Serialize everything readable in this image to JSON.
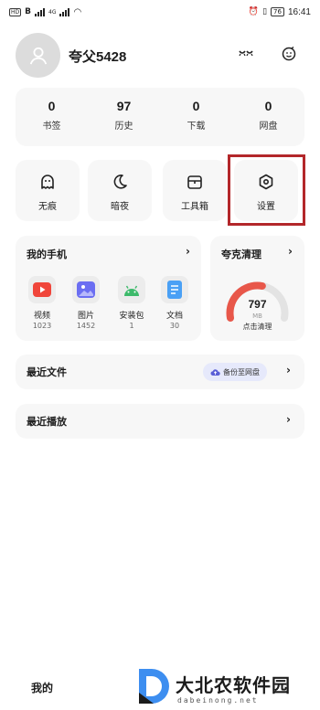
{
  "status_bar": {
    "left_badges": [
      "HD",
      "B"
    ],
    "network": "4G",
    "battery": "76",
    "time": "16:41"
  },
  "profile": {
    "username": "夸父5428",
    "icons": [
      "eyes-closed-icon",
      "smile-face-icon"
    ]
  },
  "stats": [
    {
      "value": "0",
      "label": "书签"
    },
    {
      "value": "97",
      "label": "历史"
    },
    {
      "value": "0",
      "label": "下载"
    },
    {
      "value": "0",
      "label": "网盘"
    }
  ],
  "tools": [
    {
      "label": "无痕",
      "icon": "ghost-icon"
    },
    {
      "label": "暗夜",
      "icon": "moon-icon"
    },
    {
      "label": "工具箱",
      "icon": "toolbox-icon"
    },
    {
      "label": "设置",
      "icon": "settings-hexagon-icon"
    }
  ],
  "my_phone": {
    "title": "我的手机",
    "apps": [
      {
        "name": "视频",
        "count": "1023",
        "color": "#f0453a",
        "icon": "video-play-icon"
      },
      {
        "name": "图片",
        "count": "1452",
        "color": "#6b6ef2",
        "icon": "image-icon"
      },
      {
        "name": "安装包",
        "count": "1",
        "color": "#3dba6b",
        "icon": "android-icon"
      },
      {
        "name": "文档",
        "count": "30",
        "color": "#4aa0f5",
        "icon": "document-icon"
      }
    ]
  },
  "cleaner": {
    "title": "夸克清理",
    "value": "797",
    "unit": "MB",
    "action": "点击清理",
    "gauge_fraction": 0.55,
    "gauge_color": "#e8574a"
  },
  "recent_files": {
    "title": "最近文件",
    "backup_label": "备份至网盘"
  },
  "recent_play": {
    "title": "最近播放"
  },
  "bottom_nav": {
    "mine": "我的"
  },
  "watermark": {
    "main": "大北农软件园",
    "sub": "dabeinong.net",
    "accent": "#3d8ef0"
  }
}
